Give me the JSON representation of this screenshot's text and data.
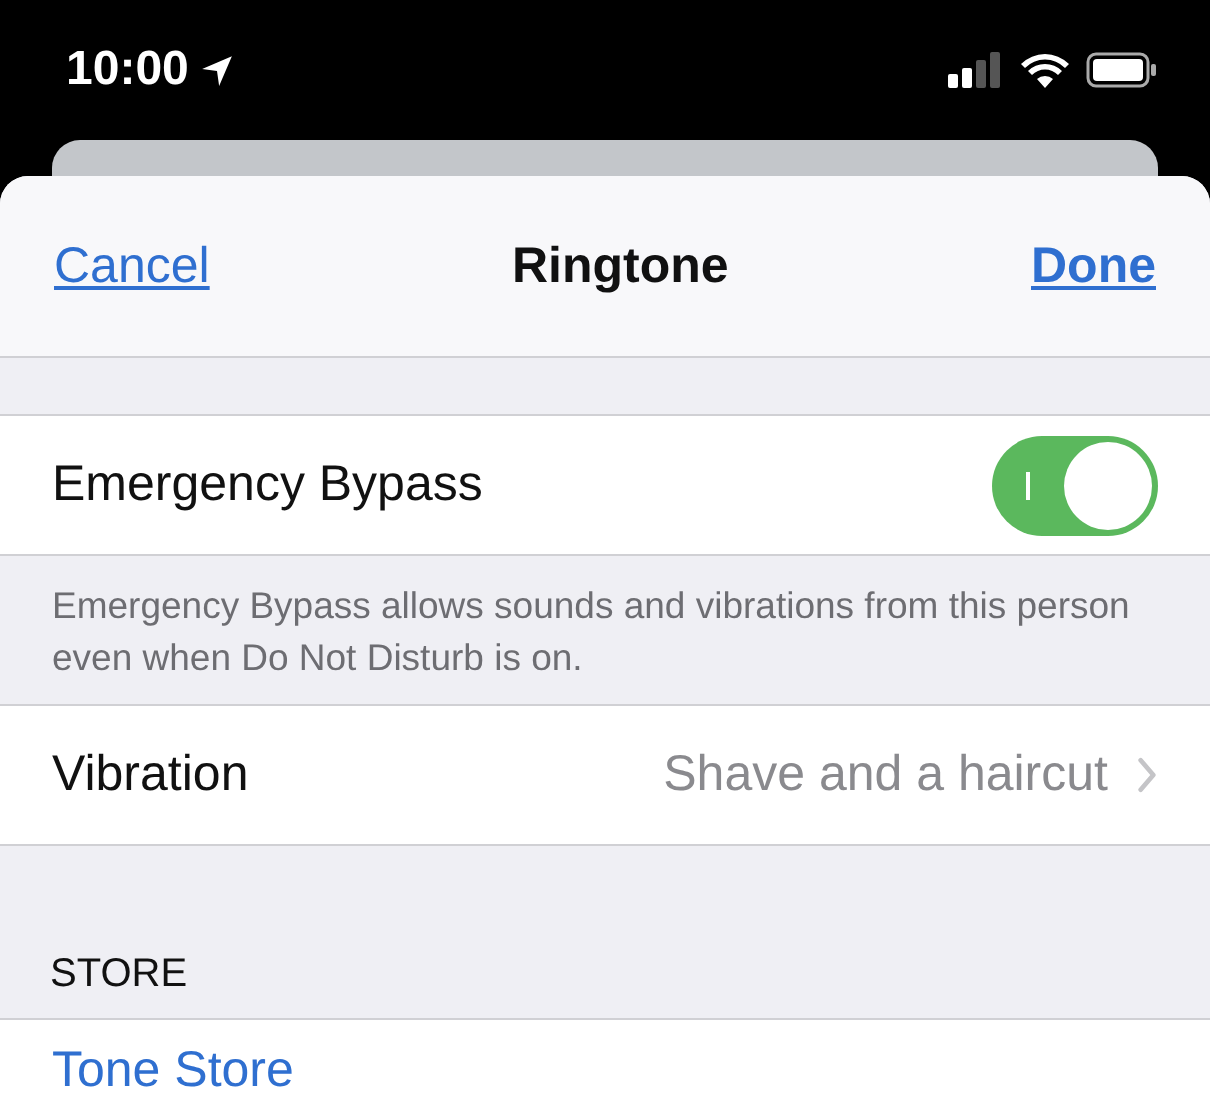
{
  "status_bar": {
    "time": "10:00"
  },
  "nav": {
    "cancel": "Cancel",
    "title": "Ringtone",
    "done": "Done"
  },
  "bypass": {
    "label": "Emergency Bypass",
    "on": true,
    "footer": "Emergency Bypass allows sounds and vibrations from this person even when Do Not Disturb is on."
  },
  "vibration": {
    "label": "Vibration",
    "value": "Shave and a haircut"
  },
  "store": {
    "header": "STORE",
    "link": "Tone Store"
  }
}
